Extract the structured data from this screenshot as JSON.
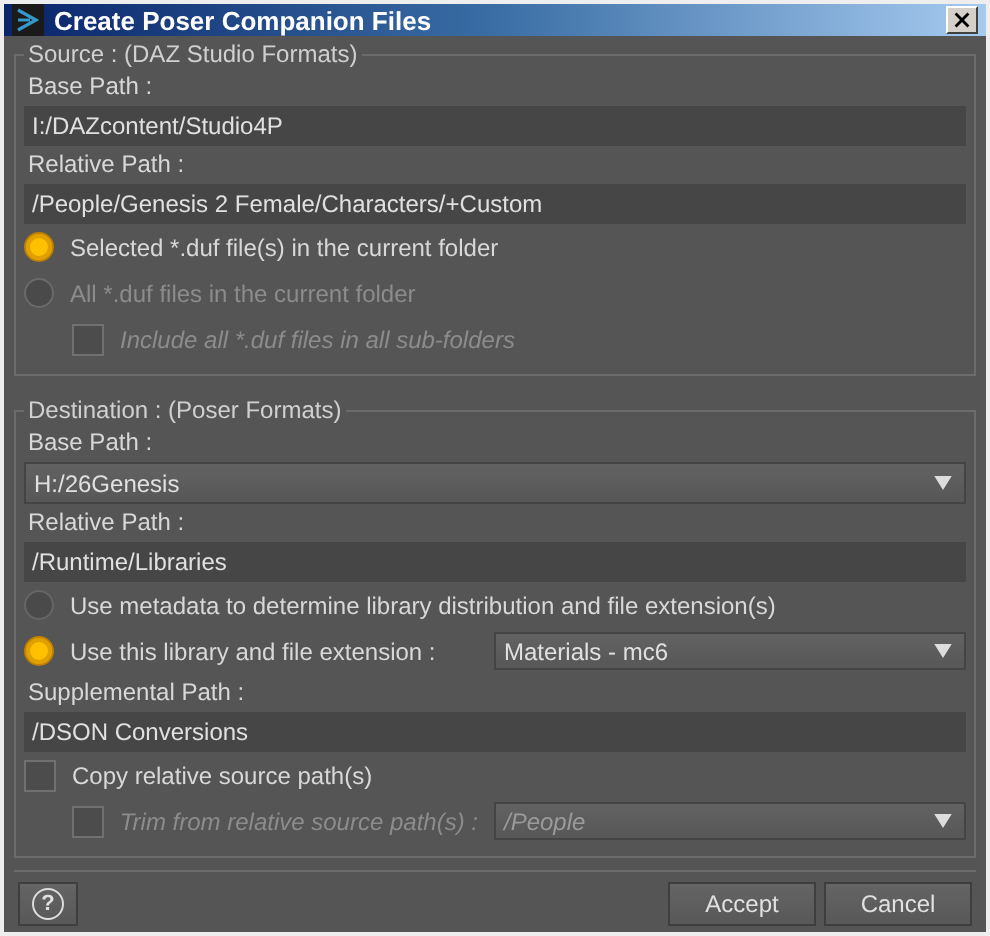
{
  "window": {
    "title": "Create Poser Companion Files"
  },
  "source": {
    "legend": "Source : (DAZ Studio Formats)",
    "base_path": {
      "label": "Base Path :",
      "value": "I:/DAZcontent/Studio4P"
    },
    "relative_path": {
      "label": "Relative Path :",
      "value": "/People/Genesis 2 Female/Characters/+Custom"
    },
    "options": [
      {
        "kind": "radio",
        "label": "Selected *.duf file(s) in the current folder",
        "selected": true,
        "disabled": false
      },
      {
        "kind": "radio",
        "label": "All *.duf files in the current folder",
        "selected": false,
        "disabled": true,
        "children": [
          {
            "kind": "checkbox",
            "label": "Include all *.duf files in all sub-folders",
            "checked": false,
            "disabled": true
          }
        ]
      }
    ]
  },
  "destination": {
    "legend": "Destination : (Poser Formats)",
    "base_path": {
      "label": "Base Path :",
      "value": "H:/26Genesis"
    },
    "relative_path": {
      "label": "Relative Path :",
      "value": "/Runtime/Libraries"
    },
    "options": [
      {
        "kind": "radio",
        "label": "Use metadata to determine library distribution and file extension(s)",
        "selected": false,
        "disabled": false
      },
      {
        "kind": "radio",
        "label": "Use this library and file extension :",
        "selected": true,
        "disabled": false,
        "dropdown": "Materials - mc6"
      }
    ],
    "supplemental_path": {
      "label": "Supplemental Path :",
      "value": "/DSON Conversions"
    },
    "copy_options": [
      {
        "kind": "checkbox",
        "label": "Copy relative source path(s)",
        "checked": false,
        "disabled": false,
        "children": [
          {
            "kind": "checkbox",
            "label": "Trim from relative source path(s) :",
            "checked": false,
            "disabled": true,
            "dropdown": "/People"
          }
        ]
      }
    ]
  },
  "help_button": {
    "label": "?"
  },
  "buttons": [
    "Accept",
    "Cancel"
  ]
}
